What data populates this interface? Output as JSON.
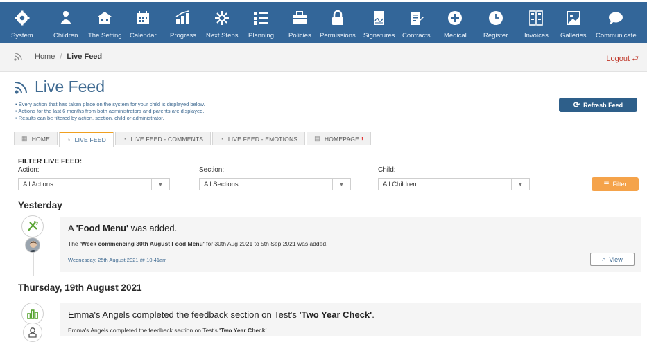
{
  "nav": {
    "items": [
      {
        "label": "System",
        "icon": "gear-icon"
      },
      {
        "label": "Children",
        "icon": "children-icon"
      },
      {
        "label": "The Setting",
        "icon": "building-icon"
      },
      {
        "label": "Calendar",
        "icon": "calendar-icon"
      },
      {
        "label": "Progress",
        "icon": "progress-chart-icon"
      },
      {
        "label": "Next Steps",
        "icon": "next-steps-icon"
      },
      {
        "label": "Planning",
        "icon": "planning-list-icon"
      },
      {
        "label": "Policies",
        "icon": "briefcase-icon"
      },
      {
        "label": "Permissions",
        "icon": "lock-icon"
      },
      {
        "label": "Signatures",
        "icon": "signature-icon"
      },
      {
        "label": "Contracts",
        "icon": "document-edit-icon"
      },
      {
        "label": "Medical",
        "icon": "medical-cross-icon"
      },
      {
        "label": "Register",
        "icon": "clock-icon"
      },
      {
        "label": "Invoices",
        "icon": "invoice-icon"
      },
      {
        "label": "Galleries",
        "icon": "gallery-icon"
      },
      {
        "label": "Communicate",
        "icon": "chat-icon"
      }
    ]
  },
  "breadcrumb": {
    "home": "Home",
    "separator": "/",
    "current": "Live Feed"
  },
  "logout": {
    "label": "Logout"
  },
  "page": {
    "title": "Live Feed",
    "notes": [
      "Every action that has taken place on the system for your child is displayed below.",
      "Actions for the last 6 months from both administrators and parents are displayed.",
      "Results can be filtered by action, section, child or administrator."
    ],
    "refresh_label": "Refresh Feed"
  },
  "tabs": [
    {
      "label": "HOME"
    },
    {
      "label": "LIVE FEED"
    },
    {
      "label": "LIVE FEED - COMMENTS"
    },
    {
      "label": "LIVE FEED - EMOTIONS"
    },
    {
      "label": "HOMEPAGE",
      "badge": "!"
    }
  ],
  "filter": {
    "heading": "FILTER LIVE FEED:",
    "action_label": "Action:",
    "action_value": "All Actions",
    "section_label": "Section:",
    "section_value": "All Sections",
    "child_label": "Child:",
    "child_value": "All Children",
    "button_label": "Filter"
  },
  "feed": [
    {
      "day": "Yesterday",
      "title_pre": "A ",
      "title_bold": "'Food Menu'",
      "title_post": " was added.",
      "desc_pre": "The ",
      "desc_bold": "'Week commencing 30th August Food Menu'",
      "desc_post": " for 30th Aug 2021 to 5th Sep 2021 was added.",
      "date": "Wednesday, 25th August 2021 @ 10:41am",
      "view_label": "View"
    },
    {
      "day": "Thursday, 19th August 2021",
      "title_pre": "Emma's Angels completed the feedback section on Test's ",
      "title_bold": "'Two Year Check'",
      "title_post": ".",
      "desc_pre": "Emma's Angels completed the feedback section on Test's ",
      "desc_bold": "'Two Year Check'",
      "desc_post": "."
    }
  ],
  "colors": {
    "nav_bg": "#336699",
    "accent_blue": "#3f6a91",
    "refresh_btn": "#2e5f8a",
    "filter_btn": "#f5a34a",
    "logout": "#c0392b"
  }
}
